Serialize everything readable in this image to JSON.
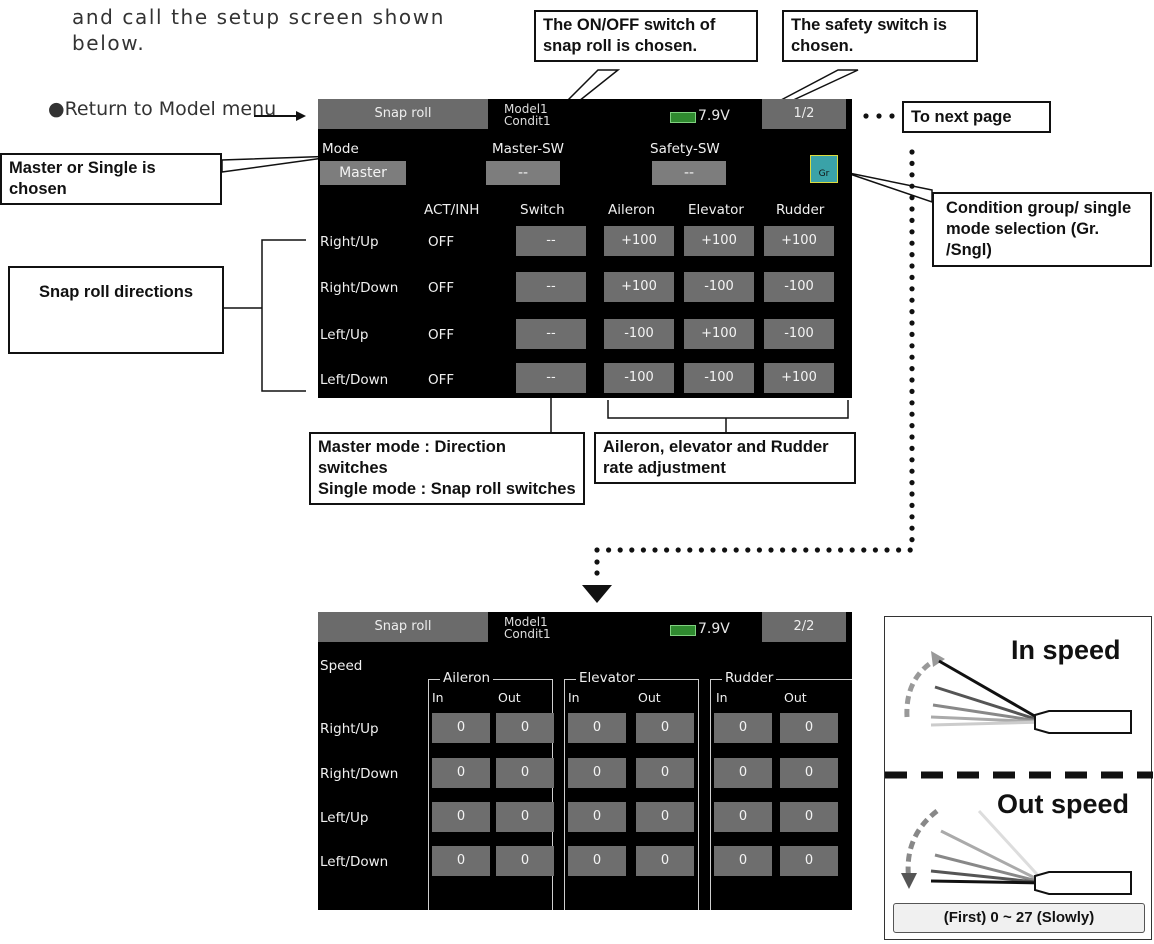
{
  "intro": {
    "line1": "and call the setup screen shown",
    "line2": "below."
  },
  "return_label": "●Return to Model menu",
  "callouts": {
    "onoff": "The ON/OFF switch of snap roll is chosen.",
    "safety": "The safety switch is chosen.",
    "next_page": "To next page",
    "master_single": "Master or Single is chosen",
    "condition": "Condition group/ single mode selection (Gr. /Sngl)",
    "directions": "Snap roll directions",
    "master_mode_1": "Master mode : Direction switches",
    "master_mode_2": "Single mode : Snap roll switches",
    "rate_adj": "Aileron, elevator and Rudder rate adjustment"
  },
  "screen1": {
    "title": "Snap roll",
    "model": "Model1",
    "condition": "Condit1",
    "voltage": "7.9V",
    "page": "1/2",
    "mode_label": "Mode",
    "mode_value": "Master",
    "master_sw_label": "Master-SW",
    "master_sw_value": "--",
    "safety_sw_label": "Safety-SW",
    "safety_sw_value": "--",
    "group_icon_text": "Gr",
    "columns": [
      "ACT/INH",
      "Switch",
      "Aileron",
      "Elevator",
      "Rudder"
    ],
    "rows": [
      {
        "name": "Right/Up",
        "act": "OFF",
        "switch": "--",
        "aileron": "+100",
        "elevator": "+100",
        "rudder": "+100"
      },
      {
        "name": "Right/Down",
        "act": "OFF",
        "switch": "--",
        "aileron": "+100",
        "elevator": "-100",
        "rudder": "-100"
      },
      {
        "name": "Left/Up",
        "act": "OFF",
        "switch": "--",
        "aileron": "-100",
        "elevator": "+100",
        "rudder": "-100"
      },
      {
        "name": "Left/Down",
        "act": "OFF",
        "switch": "--",
        "aileron": "-100",
        "elevator": "-100",
        "rudder": "+100"
      }
    ]
  },
  "screen2": {
    "title": "Snap roll",
    "model": "Model1",
    "condition": "Condit1",
    "voltage": "7.9V",
    "page": "2/2",
    "speed_label": "Speed",
    "groups": [
      "Aileron",
      "Elevator",
      "Rudder"
    ],
    "in_label": "In",
    "out_label": "Out",
    "rows": [
      {
        "name": "Right/Up",
        "values": [
          "0",
          "0",
          "0",
          "0",
          "0",
          "0"
        ]
      },
      {
        "name": "Right/Down",
        "values": [
          "0",
          "0",
          "0",
          "0",
          "0",
          "0"
        ]
      },
      {
        "name": "Left/Up",
        "values": [
          "0",
          "0",
          "0",
          "0",
          "0",
          "0"
        ]
      },
      {
        "name": "Left/Down",
        "values": [
          "0",
          "0",
          "0",
          "0",
          "0",
          "0"
        ]
      }
    ]
  },
  "speed_panel": {
    "in_speed": "In speed",
    "out_speed": "Out speed",
    "range": "(First) 0 ~ 27 (Slowly)"
  },
  "colors": {
    "screen_bg": "#000000",
    "cell_bg": "#6e6e6e",
    "battery": "#2f8a2f"
  }
}
